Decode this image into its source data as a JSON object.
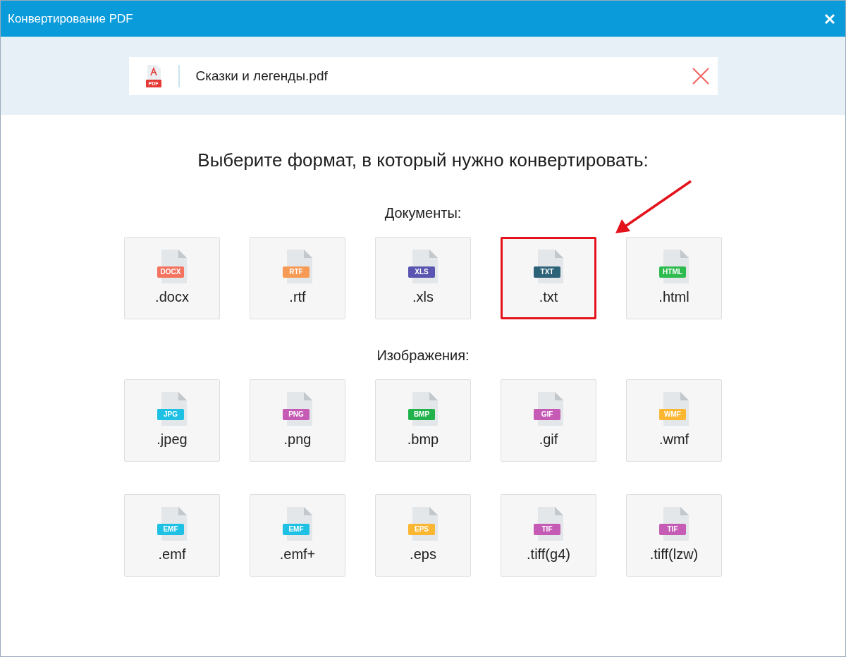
{
  "window": {
    "title": "Конвертирование PDF"
  },
  "file": {
    "badge": "PDF",
    "name": "Сказки и легенды.pdf"
  },
  "heading": "Выберите формат, в который нужно конвертировать:",
  "sections": [
    {
      "title": "Документы:",
      "rows": [
        [
          {
            "badge": "DOCX",
            "color": "#f4735f",
            "label": ".docx",
            "highlighted": false
          },
          {
            "badge": "RTF",
            "color": "#f79a55",
            "label": ".rtf",
            "highlighted": false
          },
          {
            "badge": "XLS",
            "color": "#5a55b0",
            "label": ".xls",
            "highlighted": false
          },
          {
            "badge": "TXT",
            "color": "#2d6378",
            "label": ".txt",
            "highlighted": true
          },
          {
            "badge": "HTML",
            "color": "#2dbb4f",
            "label": ".html",
            "highlighted": false
          }
        ]
      ]
    },
    {
      "title": "Изображения:",
      "rows": [
        [
          {
            "badge": "JPG",
            "color": "#1ec0e4",
            "label": ".jpeg",
            "highlighted": false
          },
          {
            "badge": "PNG",
            "color": "#c55bb5",
            "label": ".png",
            "highlighted": false
          },
          {
            "badge": "BMP",
            "color": "#22b24c",
            "label": ".bmp",
            "highlighted": false
          },
          {
            "badge": "GIF",
            "color": "#c55bb5",
            "label": ".gif",
            "highlighted": false
          },
          {
            "badge": "WMF",
            "color": "#fbb632",
            "label": ".wmf",
            "highlighted": false
          }
        ],
        [
          {
            "badge": "EMF",
            "color": "#1ec0e4",
            "label": ".emf",
            "highlighted": false
          },
          {
            "badge": "EMF",
            "color": "#1ec0e4",
            "label": ".emf+",
            "highlighted": false
          },
          {
            "badge": "EPS",
            "color": "#fbb632",
            "label": ".eps",
            "highlighted": false
          },
          {
            "badge": "TIF",
            "color": "#c55bb5",
            "label": ".tiff(g4)",
            "highlighted": false
          },
          {
            "badge": "TIF",
            "color": "#c55bb5",
            "label": ".tiff(lzw)",
            "highlighted": false
          }
        ]
      ]
    }
  ]
}
